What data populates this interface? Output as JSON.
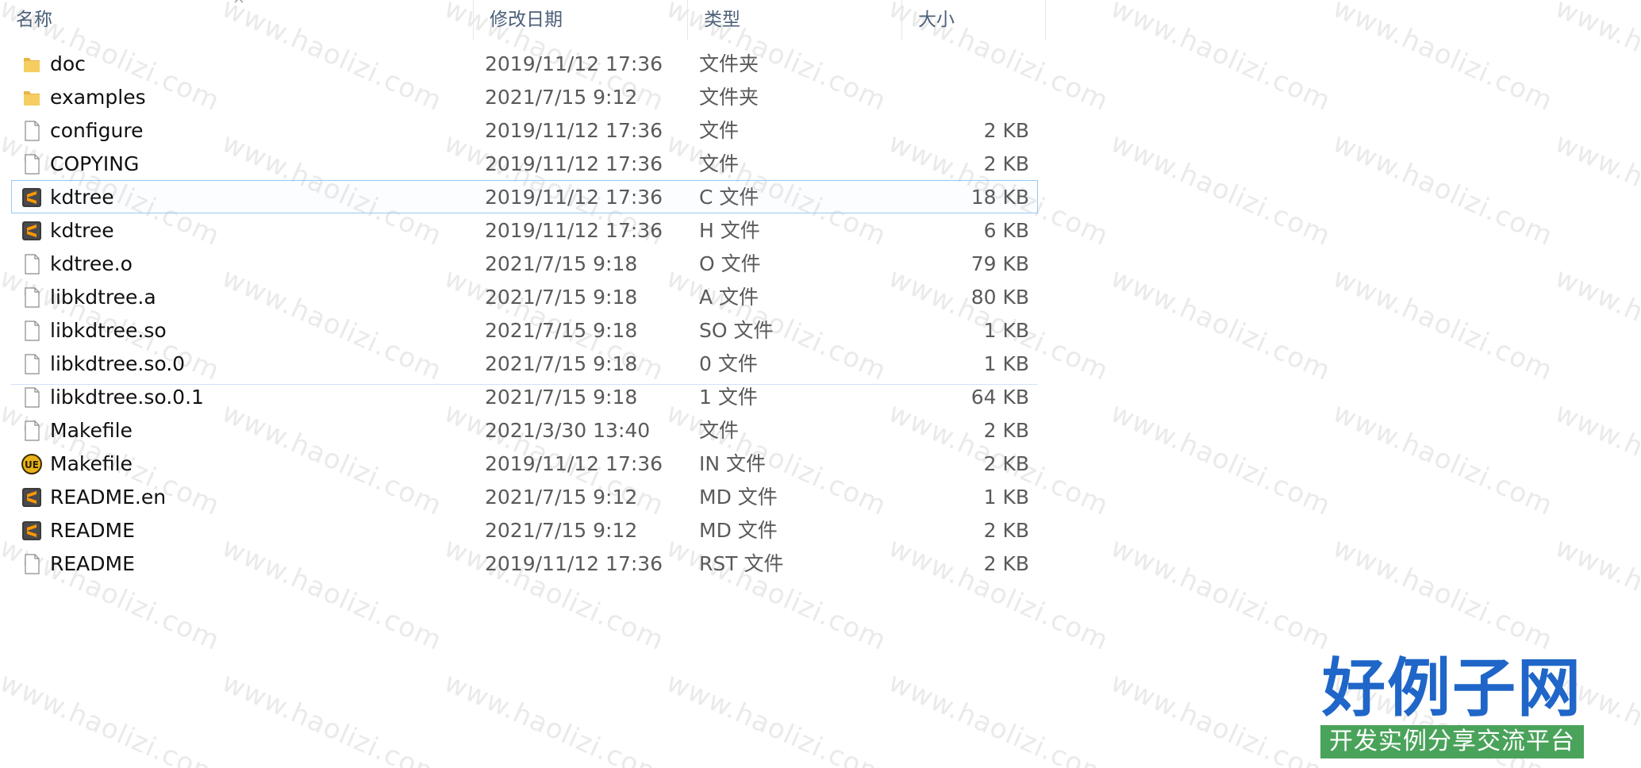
{
  "columns": {
    "name": "名称",
    "date": "修改日期",
    "type": "类型",
    "size": "大小"
  },
  "files": [
    {
      "name": "doc",
      "date": "2019/11/12 17:36",
      "type": "文件夹",
      "size": "",
      "icon": "folder-icon"
    },
    {
      "name": "examples",
      "date": "2021/7/15 9:12",
      "type": "文件夹",
      "size": "",
      "icon": "folder-icon"
    },
    {
      "name": "configure",
      "date": "2019/11/12 17:36",
      "type": "文件",
      "size": "2 KB",
      "icon": "file-icon"
    },
    {
      "name": "COPYING",
      "date": "2019/11/12 17:36",
      "type": "文件",
      "size": "2 KB",
      "icon": "file-icon"
    },
    {
      "name": "kdtree",
      "date": "2019/11/12 17:36",
      "type": "C 文件",
      "size": "18 KB",
      "icon": "sublime-text-icon",
      "selected": true
    },
    {
      "name": "kdtree",
      "date": "2019/11/12 17:36",
      "type": "H 文件",
      "size": "6 KB",
      "icon": "sublime-text-icon"
    },
    {
      "name": "kdtree.o",
      "date": "2021/7/15 9:18",
      "type": "O 文件",
      "size": "79 KB",
      "icon": "file-icon"
    },
    {
      "name": "libkdtree.a",
      "date": "2021/7/15 9:18",
      "type": "A 文件",
      "size": "80 KB",
      "icon": "file-icon"
    },
    {
      "name": "libkdtree.so",
      "date": "2021/7/15 9:18",
      "type": "SO 文件",
      "size": "1 KB",
      "icon": "file-icon"
    },
    {
      "name": "libkdtree.so.0",
      "date": "2021/7/15 9:18",
      "type": "0 文件",
      "size": "1 KB",
      "icon": "file-icon"
    },
    {
      "name": "libkdtree.so.0.1",
      "date": "2021/7/15 9:18",
      "type": "1 文件",
      "size": "64 KB",
      "icon": "file-icon"
    },
    {
      "name": "Makefile",
      "date": "2021/3/30 13:40",
      "type": "文件",
      "size": "2 KB",
      "icon": "file-icon"
    },
    {
      "name": "Makefile",
      "date": "2019/11/12 17:36",
      "type": "IN 文件",
      "size": "2 KB",
      "icon": "ultraedit-icon"
    },
    {
      "name": "README.en",
      "date": "2021/7/15 9:12",
      "type": "MD 文件",
      "size": "1 KB",
      "icon": "sublime-text-icon"
    },
    {
      "name": "README",
      "date": "2021/7/15 9:12",
      "type": "MD 文件",
      "size": "2 KB",
      "icon": "sublime-text-icon"
    },
    {
      "name": "README",
      "date": "2019/11/12 17:36",
      "type": "RST 文件",
      "size": "2 KB",
      "icon": "file-icon"
    }
  ],
  "watermark": {
    "text": "www.haolizi.com"
  },
  "logo": {
    "title": "好例子网",
    "subtitle": "开发实例分享交流平台"
  },
  "colors": {
    "header_text": "#4c607a",
    "selection_border": "#99c9f5",
    "folder": "#f2c55c",
    "logo_blue": "#1f66c8",
    "logo_green": "#4aa35a"
  }
}
